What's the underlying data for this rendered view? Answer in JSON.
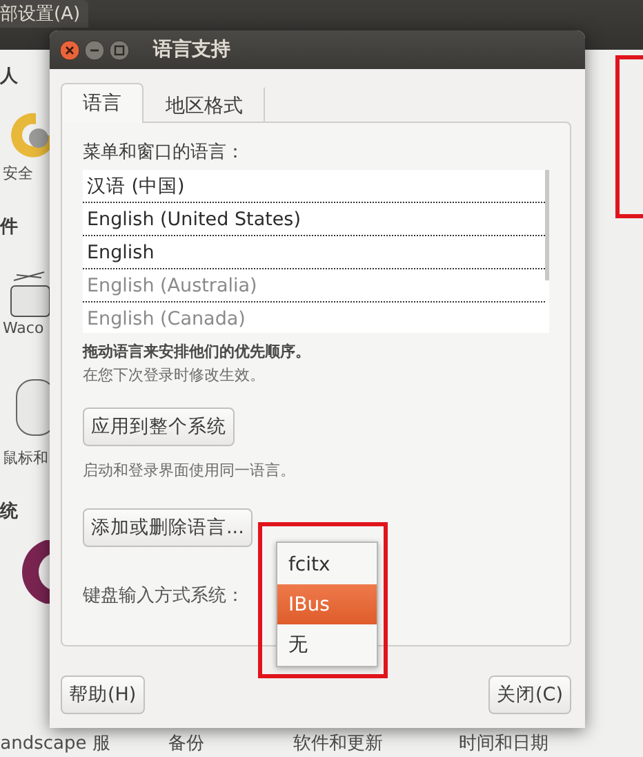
{
  "background": {
    "menu_tab": "部设置(A)",
    "side_labels": [
      {
        "text": "人",
        "kind": "heading"
      },
      {
        "text": "安全",
        "kind": "item"
      },
      {
        "text": "件",
        "kind": "heading"
      },
      {
        "text": "Waco",
        "kind": "item"
      },
      {
        "text": "鼠标和",
        "kind": "item"
      },
      {
        "text": "统",
        "kind": "heading"
      }
    ],
    "bottom_labels": [
      "andscape 服",
      "备份",
      "软件和更新",
      "时间和日期"
    ]
  },
  "dialog": {
    "title": "语言支持",
    "tabs": [
      {
        "label": "语言",
        "selected": true
      },
      {
        "label": "地区格式",
        "selected": false
      }
    ],
    "list_label": "菜单和窗口的语言：",
    "languages": [
      {
        "name": "汉语 (中国)",
        "inactive": false
      },
      {
        "name": "English (United States)",
        "inactive": false
      },
      {
        "name": "English",
        "inactive": false
      },
      {
        "name": "English (Australia)",
        "inactive": true
      },
      {
        "name": "English (Canada)",
        "inactive": true
      }
    ],
    "hint_bold": "拖动语言来安排他们的优先顺序。",
    "hint": "在您下次登录时修改生效。",
    "apply_button": "应用到整个系统",
    "apply_note": "启动和登录界面使用同一语言。",
    "add_button": "添加或删除语言...",
    "input_label": "键盘输入方式系统：",
    "input_options": [
      {
        "label": "fcitx",
        "selected": false
      },
      {
        "label": "IBus",
        "selected": true
      },
      {
        "label": "无",
        "selected": false
      }
    ],
    "help_button": "帮助(H)",
    "close_button": "关闭(C)"
  }
}
